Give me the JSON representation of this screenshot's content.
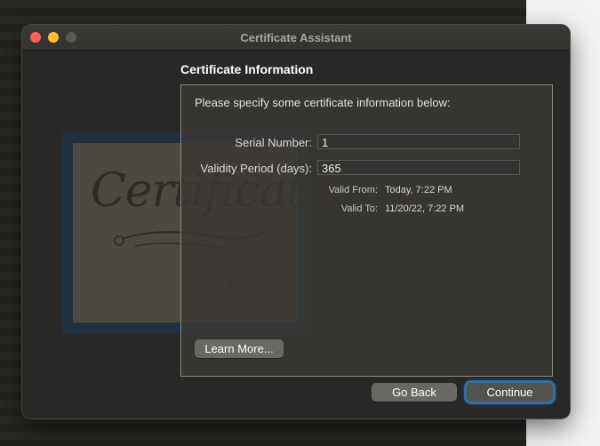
{
  "window": {
    "title": "Certificate Assistant"
  },
  "illustration": {
    "script_text": "Certificate"
  },
  "section": {
    "heading": "Certificate Information"
  },
  "form": {
    "intro": "Please specify some certificate information below:",
    "serial_label": "Serial Number:",
    "serial_value": "1",
    "validity_label": "Validity Period (days):",
    "validity_value": "365",
    "valid_from_label": "Valid From:",
    "valid_from_value": "Today, 7:22 PM",
    "valid_to_label": "Valid To:",
    "valid_to_value": "11/20/22, 7:22 PM"
  },
  "buttons": {
    "learn_more": "Learn More...",
    "go_back": "Go Back",
    "continue": "Continue"
  },
  "colors": {
    "accent_focus_ring": "#2f6fa6",
    "close": "#fe5f57",
    "minimize": "#febc2e"
  }
}
